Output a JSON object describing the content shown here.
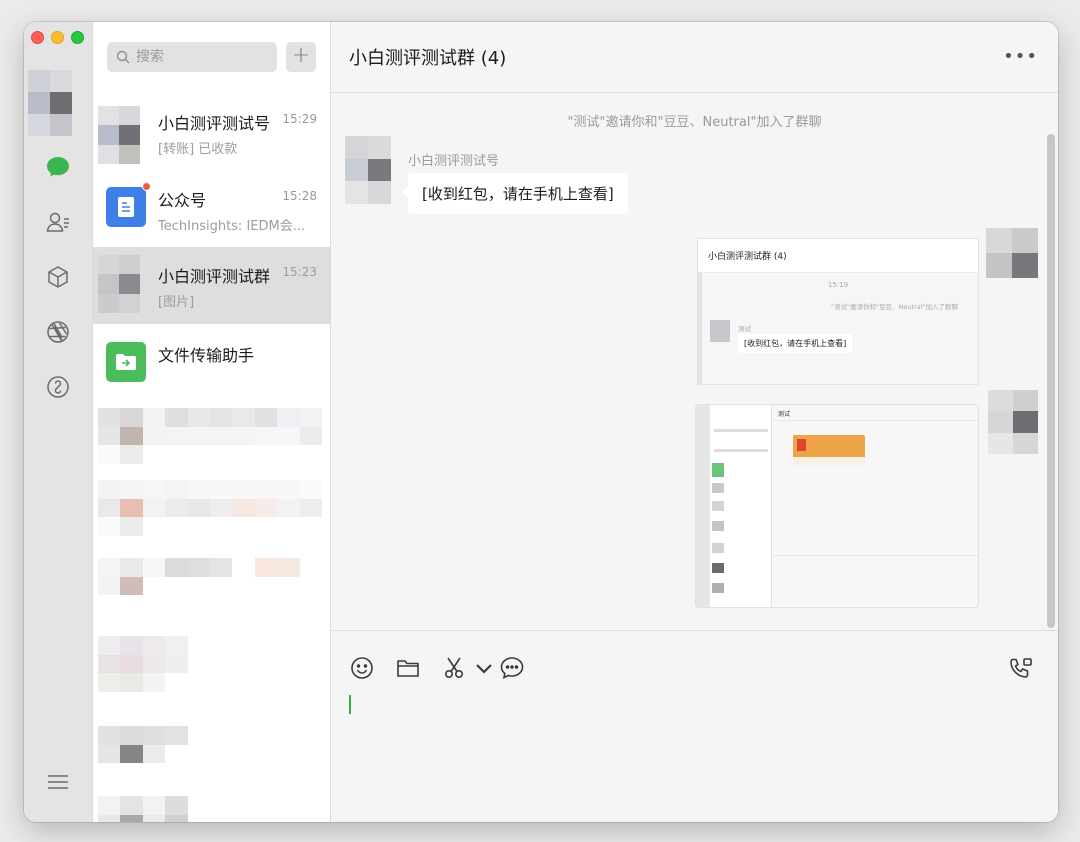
{
  "window": {
    "traffic_lights": [
      "close",
      "minimize",
      "zoom"
    ]
  },
  "nav": {
    "items": [
      {
        "name": "chat-icon",
        "active": true,
        "color": "#3bb550"
      },
      {
        "name": "contacts-icon",
        "active": false
      },
      {
        "name": "favorites-icon",
        "active": false
      },
      {
        "name": "moments-icon",
        "active": false
      },
      {
        "name": "miniprogram-icon",
        "active": false
      }
    ],
    "menu_icon": "hamburger-icon"
  },
  "search": {
    "placeholder": "搜索",
    "add_label": "+"
  },
  "conversations": [
    {
      "title": "小白测评测试号",
      "time": "15:29",
      "preview": "[转账] 已收款",
      "active": false
    },
    {
      "title": "公众号",
      "time": "15:28",
      "preview": "TechInsights: IEDM会...",
      "active": false,
      "unread_dot": true
    },
    {
      "title": "小白测评测试群",
      "time": "15:23",
      "preview": "[图片]",
      "active": true
    },
    {
      "title": "文件传输助手",
      "time": "",
      "preview": "",
      "active": false
    }
  ],
  "chat": {
    "title": "小白测评测试群 (4)",
    "more_label": "•••",
    "system_message": "\"测试\"邀请你和\"豆豆、Neutral\"加入了群聊",
    "messages": [
      {
        "sender": "小白测评测试号",
        "text": "[收到红包，请在手机上查看]",
        "side": "left"
      }
    ],
    "shared_image_1": {
      "title": "小白测评测试群 (4)",
      "time": "15:19",
      "system": "\"测试\"邀请你和\"豆豆、Neutral\"加入了群聊",
      "sender": "测试",
      "bubble": "[收到红包，请在手机上查看]"
    },
    "shared_image_2": {
      "title": "测试"
    }
  },
  "composer": {
    "tools": [
      "emoji-icon",
      "folder-icon",
      "scissors-icon",
      "chevron-down-icon",
      "chat-bubble-icon"
    ],
    "call_icon": "video-call-icon"
  }
}
